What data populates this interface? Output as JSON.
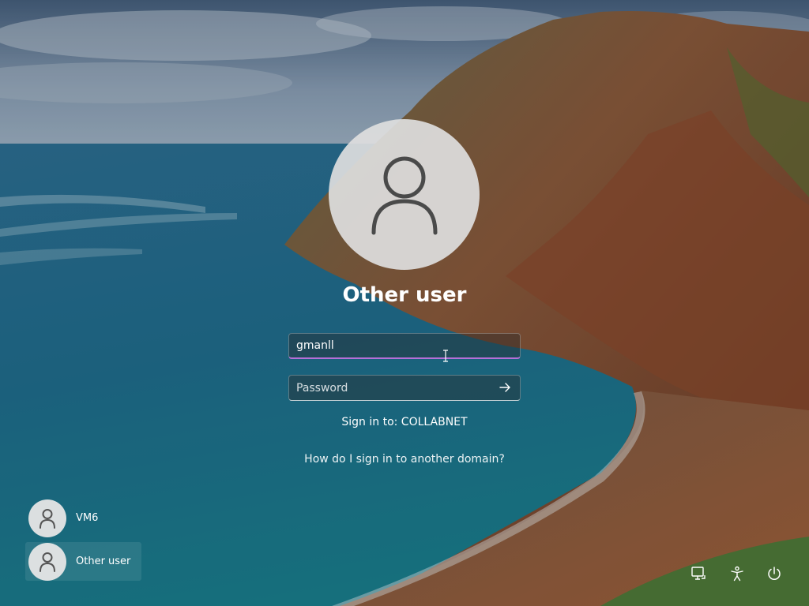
{
  "login": {
    "user_name": "Other user",
    "username_value": "gmanll",
    "password_placeholder": "Password",
    "sign_in_to": "Sign in to: COLLABNET",
    "domain_help_link": "How do I sign in to another domain?",
    "accent_color": "#b66fd8"
  },
  "user_list": [
    {
      "label": "VM6",
      "icon": "user-icon"
    },
    {
      "label": "Other user",
      "icon": "user-icon",
      "selected": true
    }
  ],
  "system_tray": [
    {
      "name": "network-icon"
    },
    {
      "name": "accessibility-icon"
    },
    {
      "name": "power-icon"
    }
  ]
}
